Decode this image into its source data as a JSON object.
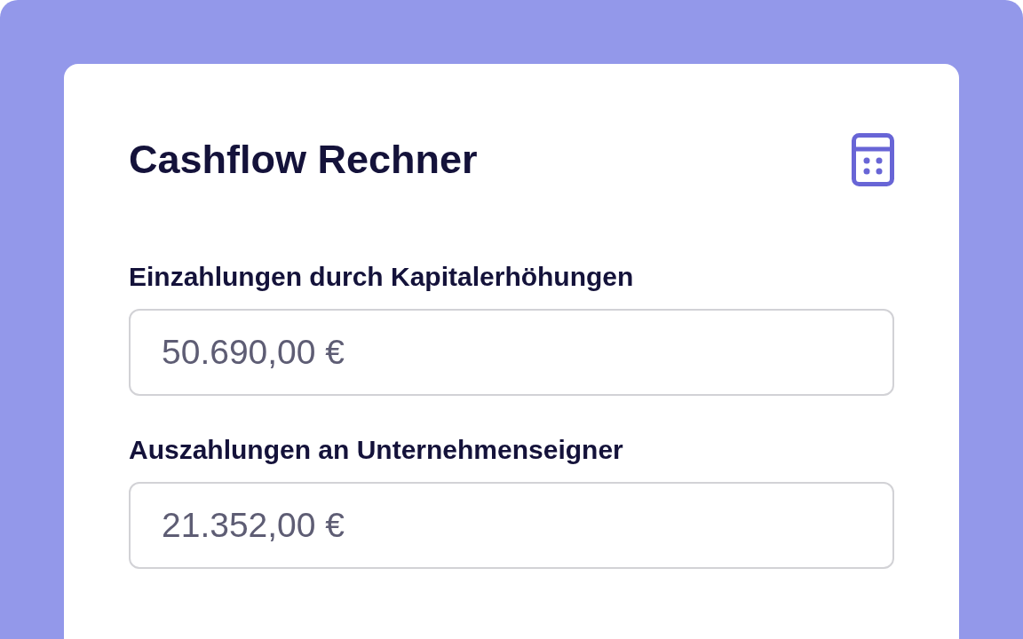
{
  "card": {
    "title": "Cashflow Rechner",
    "fields": [
      {
        "label": "Einzahlungen durch Kapitalerhöhungen",
        "value": "50.690,00 €"
      },
      {
        "label": "Auszahlungen an Unternehmenseigner",
        "value": "21.352,00 €"
      }
    ]
  }
}
